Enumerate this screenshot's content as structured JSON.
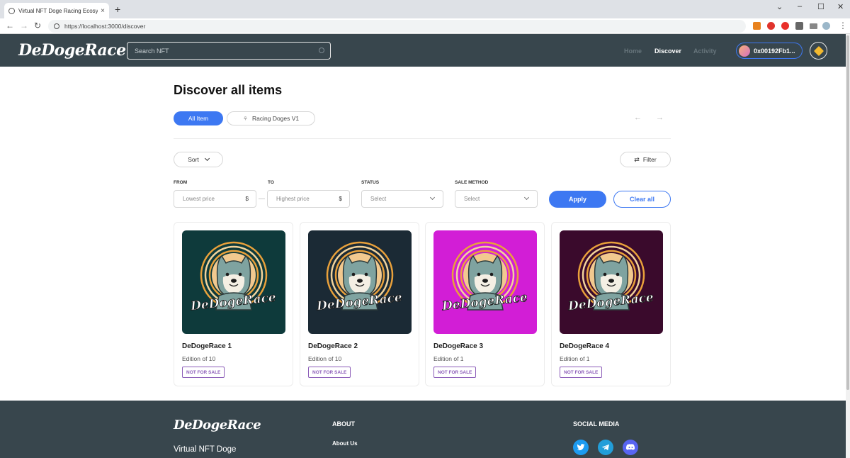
{
  "browser": {
    "tab_title": "Virtual NFT Doge Racing Ecosyst",
    "tab_close": "×",
    "new_tab": "+",
    "url": "https://localhost:3000/discover",
    "window_controls": [
      "⌄",
      "–",
      "☐",
      "✕"
    ]
  },
  "header": {
    "logo": "DeDogeRace",
    "search_placeholder": "Search NFT",
    "nav": [
      {
        "label": "Home",
        "active": false
      },
      {
        "label": "Discover",
        "active": true
      },
      {
        "label": "Activity",
        "active": false
      }
    ],
    "wallet": "0x00192Fb1...",
    "colors": {
      "bar": "#38464d",
      "accent": "#3d78f2"
    }
  },
  "main": {
    "title": "Discover all items",
    "tabs": [
      {
        "label": "All Item",
        "active": true
      },
      {
        "label": "Racing Doges V1",
        "active": false
      }
    ],
    "prev_arrow": "←",
    "next_arrow": "→",
    "sort_label": "Sort",
    "filter_label": "Filter",
    "filters": {
      "from_label": "FROM",
      "from_placeholder": "Lowest price",
      "to_label": "TO",
      "to_placeholder": "Highest price",
      "currency": "$",
      "status_label": "STATUS",
      "status_value": "Select",
      "sale_label": "SALE METHOD",
      "sale_value": "Select"
    },
    "apply_label": "Apply",
    "clear_label": "Clear all"
  },
  "cards": [
    {
      "title": "DeDogeRace 1",
      "edition": "Edition of 10",
      "badge": "NOT FOR SALE",
      "bg": "#0e3a3b"
    },
    {
      "title": "DeDogeRace 2",
      "edition": "Edition of 10",
      "badge": "NOT FOR SALE",
      "bg": "#1b2a35"
    },
    {
      "title": "DeDogeRace 3",
      "edition": "Edition of 1",
      "badge": "NOT FOR SALE",
      "bg": "#d21ed6"
    },
    {
      "title": "DeDogeRace 4",
      "edition": "Edition of 1",
      "badge": "NOT FOR SALE",
      "bg": "#3a0a2c"
    }
  ],
  "card_art_text": "DeDogeRace",
  "footer": {
    "logo": "DeDogeRace",
    "tagline": "Virtual NFT Doge",
    "about_heading": "ABOUT",
    "about_link": "About Us",
    "social_heading": "SOCIAL MEDIA",
    "social": [
      {
        "icon": "twitter-icon",
        "color": "#1d9bf0"
      },
      {
        "icon": "telegram-icon",
        "color": "#229ed9"
      },
      {
        "icon": "discord-icon",
        "color": "#5865f2"
      }
    ]
  }
}
